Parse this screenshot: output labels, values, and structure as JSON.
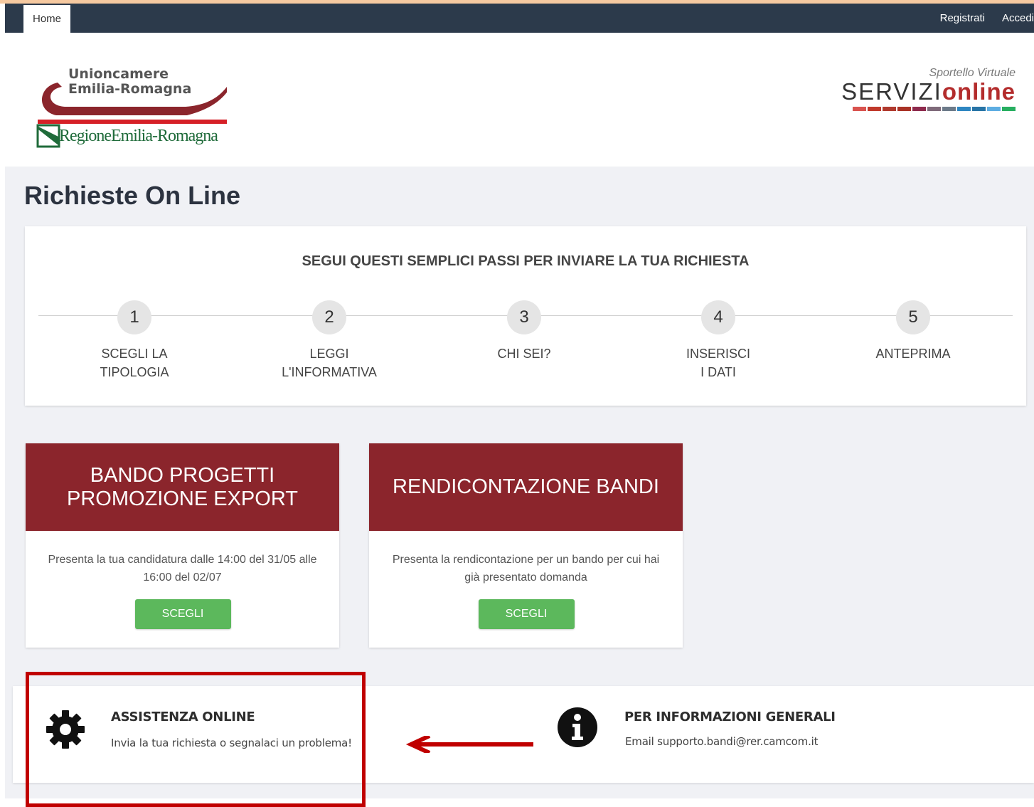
{
  "nav": {
    "home": "Home",
    "register": "Registrati",
    "login": "Accedi"
  },
  "logos": {
    "union_line1": "Unioncamere",
    "union_line2": "Emilia-Romagna",
    "regione": "RegioneEmilia-Romagna",
    "sportello": "Sportello Virtuale",
    "servizi": "SERVIZI",
    "online": "online"
  },
  "page": {
    "title": "Richieste On Line"
  },
  "steps": {
    "title": "SEGUI QUESTI SEMPLICI PASSI PER INVIARE LA TUA RICHIESTA",
    "items": [
      {
        "number": "1",
        "label": "SCEGLI LA\nTIPOLOGIA"
      },
      {
        "number": "2",
        "label": "LEGGI\nL'INFORMATIVA"
      },
      {
        "number": "3",
        "label": "CHI SEI?"
      },
      {
        "number": "4",
        "label": "INSERISCI\nI DATI"
      },
      {
        "number": "5",
        "label": "ANTEPRIMA"
      }
    ]
  },
  "cards": [
    {
      "title": "BANDO PROGETTI\nPROMOZIONE EXPORT",
      "description": "Presenta la tua candidatura dalle 14:00 del 31/05 alle 16:00 del 02/07",
      "button": "SCEGLI"
    },
    {
      "title": "RENDICONTAZIONE BANDI",
      "description": "Presenta la rendicontazione per un bando per cui hai già presentato domanda",
      "button": "SCEGLI"
    }
  ],
  "support": {
    "title": "ASSISTENZA ONLINE",
    "text": "Invia la tua richiesta o segnalaci un problema!"
  },
  "info": {
    "title": "PER INFORMAZIONI GENERALI",
    "text": "Email supporto.bandi@rer.camcom.it"
  },
  "colors": {
    "brand_red": "#8b252c",
    "button_green": "#5cb85c",
    "nav_dark": "#2c3a4b",
    "annotation_red": "#c00000"
  }
}
